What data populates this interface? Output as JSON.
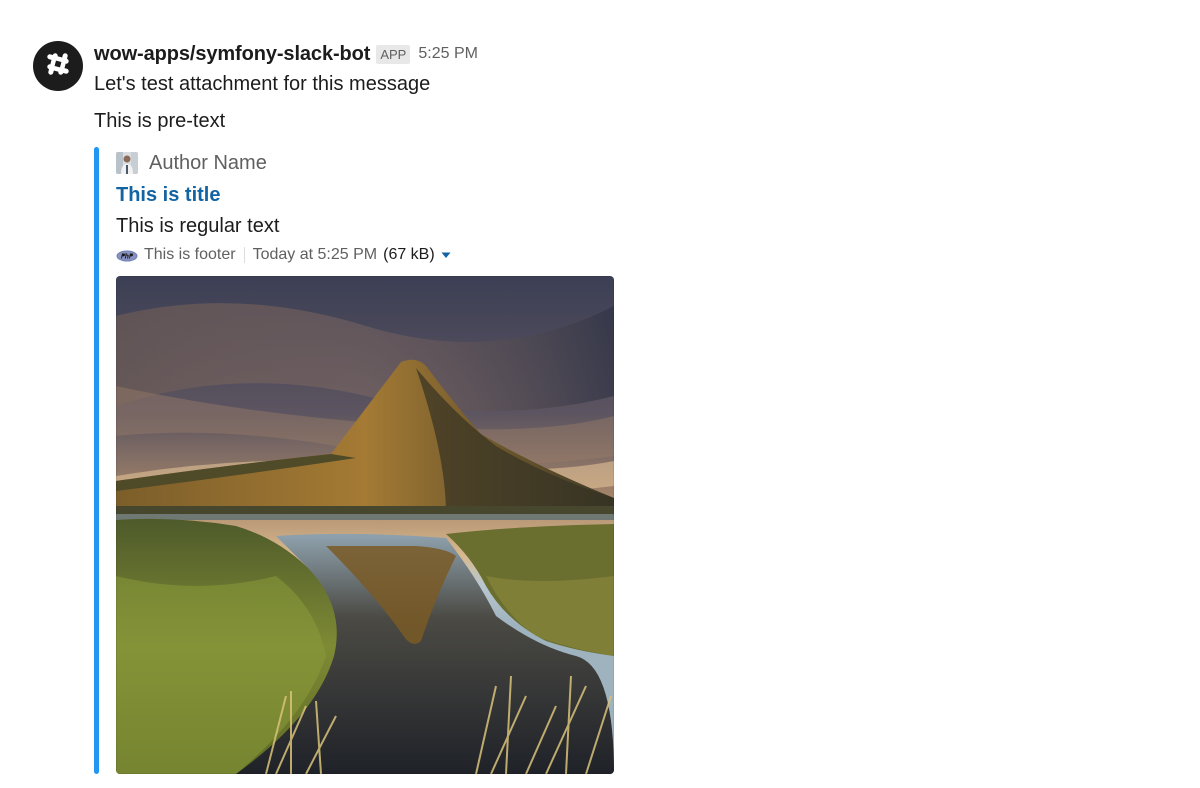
{
  "message": {
    "sender": "wow-apps/symfony-slack-bot",
    "badge": "APP",
    "time": "5:25 PM",
    "text": "Let's test attachment for this message",
    "pretext": "This is pre-text",
    "avatar_icon": "slack-hash-icon"
  },
  "attachment": {
    "color": "#2196f3",
    "author_name": "Author Name",
    "author_icon": "author-avatar-icon",
    "title": "This is title",
    "text": "This is regular text",
    "footer": "This is footer",
    "footer_icon": "php-logo-icon",
    "footer_time": "Today at 5:25 PM",
    "file_size": "(67 kB)",
    "caret_icon": "caret-down-icon",
    "image": "mountain-lake-photo"
  },
  "colors": {
    "text": "#1d1c1d",
    "muted": "#616061",
    "link": "#1264a3",
    "accent_bar": "#2196f3"
  }
}
